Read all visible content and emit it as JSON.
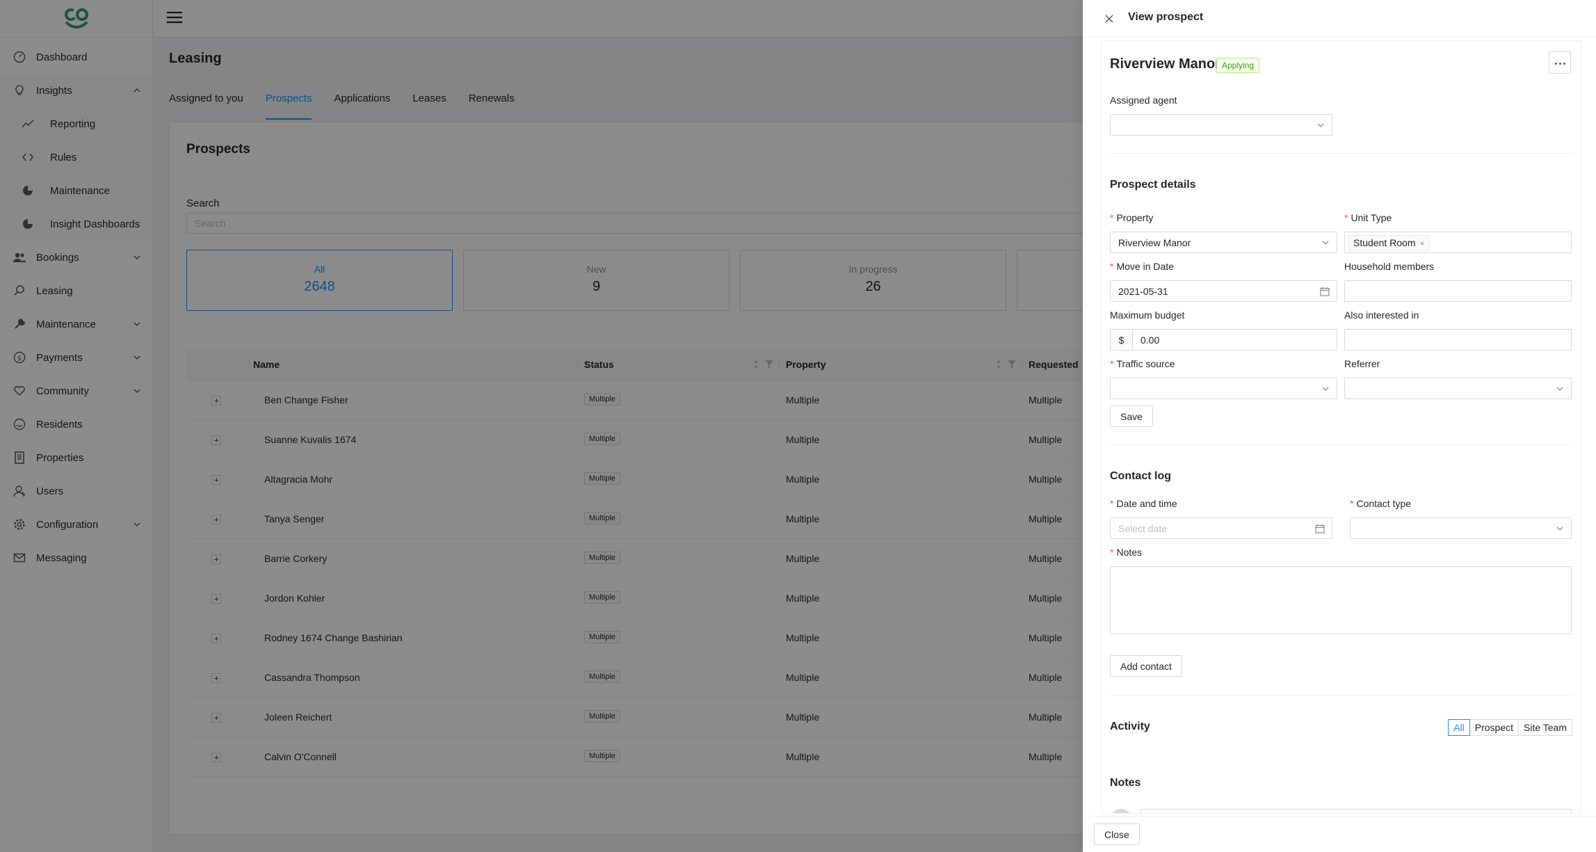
{
  "sidebar": {
    "items": [
      {
        "label": "Dashboard",
        "icon": "dashboard-icon"
      },
      {
        "label": "Insights",
        "icon": "bulb-icon"
      },
      {
        "label": "Reporting",
        "icon": "line-chart-icon"
      },
      {
        "label": "Rules",
        "icon": "code-icon"
      },
      {
        "label": "Maintenance",
        "icon": "pie-chart-icon"
      },
      {
        "label": "Insight Dashboards",
        "icon": "pie-chart-icon"
      },
      {
        "label": "Bookings",
        "icon": "team-icon"
      },
      {
        "label": "Leasing",
        "icon": "search-icon"
      },
      {
        "label": "Maintenance",
        "icon": "tool-icon"
      },
      {
        "label": "Payments",
        "icon": "dollar-icon"
      },
      {
        "label": "Community",
        "icon": "heart-icon"
      },
      {
        "label": "Residents",
        "icon": "smile-icon"
      },
      {
        "label": "Properties",
        "icon": "building-icon"
      },
      {
        "label": "Users",
        "icon": "user-icon"
      },
      {
        "label": "Configuration",
        "icon": "gear-icon"
      },
      {
        "label": "Messaging",
        "icon": "mail-icon"
      }
    ]
  },
  "page": {
    "title": "Leasing",
    "tabs": [
      "Assigned to you",
      "Prospects",
      "Applications",
      "Leases",
      "Renewals"
    ],
    "active_tab": "Prospects"
  },
  "prospects": {
    "title": "Prospects",
    "search_label": "Search",
    "search_placeholder": "Search",
    "stats": [
      {
        "label": "All",
        "value": "2648"
      },
      {
        "label": "New",
        "value": "9"
      },
      {
        "label": "In progress",
        "value": "26"
      }
    ],
    "columns": [
      "Name",
      "Status",
      "Property",
      "Requested"
    ],
    "rows": [
      {
        "name": "Ben Change Fisher",
        "status": "Multiple",
        "property": "Multiple",
        "requested": "Multiple"
      },
      {
        "name": "Suanne Kuvalis 1674",
        "status": "Multiple",
        "property": "Multiple",
        "requested": "Multiple"
      },
      {
        "name": "Altagracia Mohr",
        "status": "Multiple",
        "property": "Multiple",
        "requested": "Multiple"
      },
      {
        "name": "Tanya Senger",
        "status": "Multiple",
        "property": "Multiple",
        "requested": "Multiple"
      },
      {
        "name": "Barrie Corkery",
        "status": "Multiple",
        "property": "Multiple",
        "requested": "Multiple"
      },
      {
        "name": "Jordon Kohler",
        "status": "Multiple",
        "property": "Multiple",
        "requested": "Multiple"
      },
      {
        "name": "Rodney 1674 Change Bashirian",
        "status": "Multiple",
        "property": "Multiple",
        "requested": "Multiple"
      },
      {
        "name": "Cassandra Thompson",
        "status": "Multiple",
        "property": "Multiple",
        "requested": "Multiple"
      },
      {
        "name": "Joleen Reichert",
        "status": "Multiple",
        "property": "Multiple",
        "requested": "Multiple"
      },
      {
        "name": "Calvin O'Connell",
        "status": "Multiple",
        "property": "Multiple",
        "requested": "Multiple"
      }
    ]
  },
  "drawer": {
    "title": "View prospect",
    "prospect_name": "Riverview Manor",
    "status_tag": "Applying",
    "assigned_agent_label": "Assigned agent",
    "assigned_agent_value": "",
    "details_title": "Prospect details",
    "property_label": "Property",
    "property_value": "Riverview Manor",
    "unit_type_label": "Unit Type",
    "unit_type_tag": "Student Room",
    "move_in_label": "Move in Date",
    "move_in_value": "2021-05-31",
    "household_label": "Household members",
    "household_value": "",
    "budget_label": "Maximum budget",
    "budget_prefix": "$",
    "budget_value": "0.00",
    "also_interested_label": "Also interested in",
    "also_interested_value": "",
    "traffic_label": "Traffic source",
    "referrer_label": "Referrer",
    "save_label": "Save",
    "contact_log_title": "Contact log",
    "datetime_label": "Date and time",
    "datetime_placeholder": "Select date",
    "contact_type_label": "Contact type",
    "notes_label": "Notes",
    "add_contact_label": "Add contact",
    "activity_title": "Activity",
    "activity_filters": [
      "All",
      "Prospect",
      "Site Team"
    ],
    "notes_title": "Notes",
    "close_label": "Close"
  },
  "colors": {
    "accent": "#1890ff",
    "brand": "#2a9d6f",
    "success": "#389e0d",
    "required": "#ff4d4f"
  }
}
